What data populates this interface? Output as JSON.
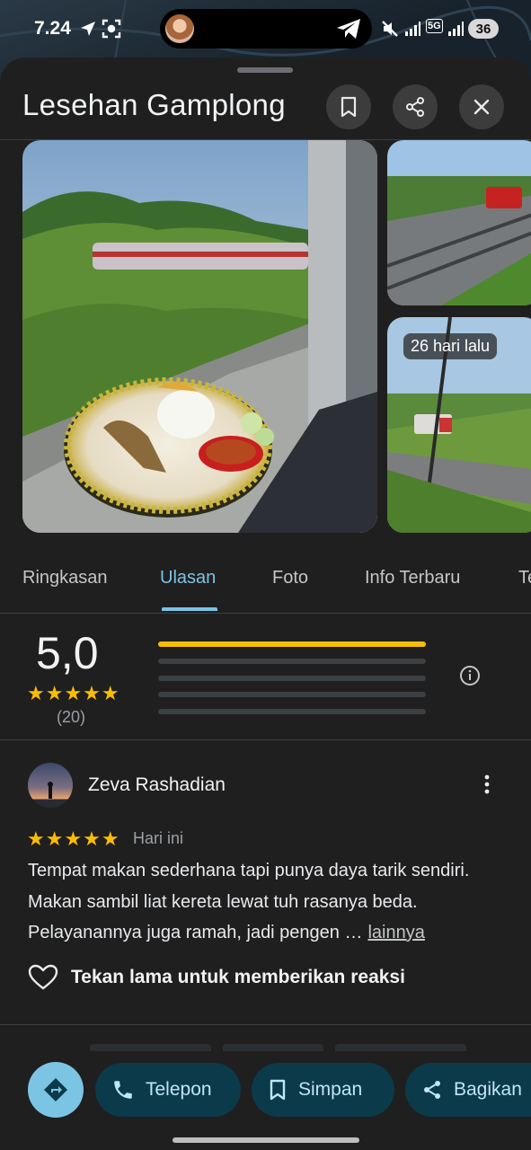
{
  "status_bar": {
    "time": "7.24",
    "network": "5G",
    "battery": "36"
  },
  "place": {
    "title": "Lesehan Gamplong"
  },
  "photos": {
    "side_badge": "26 hari lalu"
  },
  "tabs": [
    {
      "label": "Ringkasan"
    },
    {
      "label": "Ulasan"
    },
    {
      "label": "Foto"
    },
    {
      "label": "Info Terbaru"
    },
    {
      "label": "Te"
    }
  ],
  "active_tab": "Ulasan",
  "rating": {
    "score": "5,0",
    "stars": "★★★★★",
    "count": "(20)",
    "distribution": [
      1.0,
      0,
      0,
      0,
      0
    ]
  },
  "review": {
    "author": "Zeva Rashadian",
    "stars": "★★★★★",
    "date": "Hari ini",
    "text": "Tempat makan sederhana tapi punya daya tarik sendiri. Makan sambil liat kereta lewat tuh rasanya beda. Pelayanannya juga ramah, jadi pengen …",
    "more": "lainnya",
    "reaction_hint": "Tekan lama untuk memberikan reaksi"
  },
  "actions": {
    "call": "Telepon",
    "save": "Simpan",
    "share": "Bagikan"
  },
  "colors": {
    "accent": "#7cc4e4",
    "star": "#fbbc04",
    "sheet_bg": "#1f1f1f",
    "chip_bg": "#0b3a4a"
  }
}
